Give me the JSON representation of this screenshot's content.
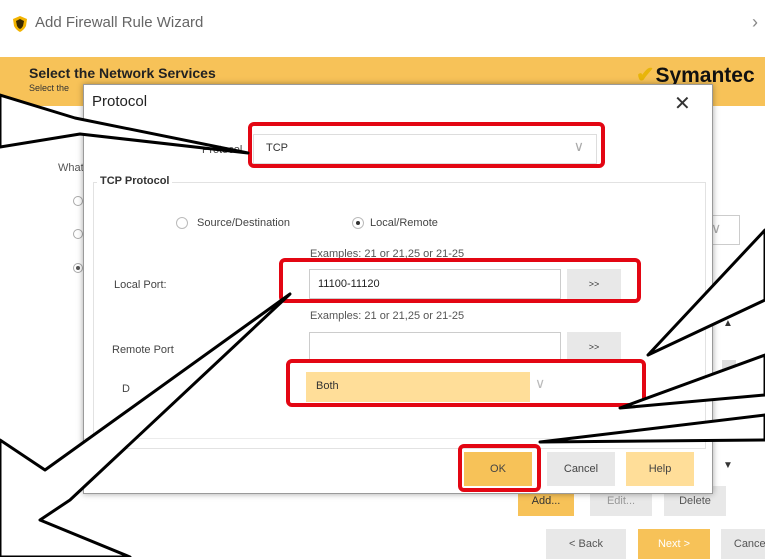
{
  "wizard": {
    "title": "Add Firewall Rule Wizard",
    "banner_title": "Select the Network Services",
    "banner_subtitle": "Select the",
    "brand": "Symantec",
    "what_text": "What",
    "buttons": {
      "add": "Add...",
      "edit": "Edit...",
      "delete": "Delete",
      "back": "< Back",
      "next": "Next >",
      "cancel": "Cancel"
    }
  },
  "dialog": {
    "title": "Protocol",
    "protocol_label": "Protocol",
    "protocol_value": "TCP",
    "group_title": "TCP Protocol",
    "radio_source_dest": "Source/Destination",
    "radio_local_remote": "Local/Remote",
    "selected_mode": "Local/Remote",
    "local_hint": "Examples: 21 or 21,25 or 21-25",
    "local_port_label": "Local Port:",
    "local_port_value": "11100-11120",
    "remote_hint": "Examples: 21 or 21,25 or 21-25",
    "remote_port_label": "Remote Port",
    "remote_port_value": "",
    "direction_label": "D",
    "direction_value": "Both",
    "add_arrow": ">>",
    "ok": "OK",
    "cancel": "Cancel",
    "help": "Help"
  },
  "colors": {
    "accent": "#f7c258",
    "accent_light": "#ffde99",
    "highlight_red": "#e30613"
  }
}
